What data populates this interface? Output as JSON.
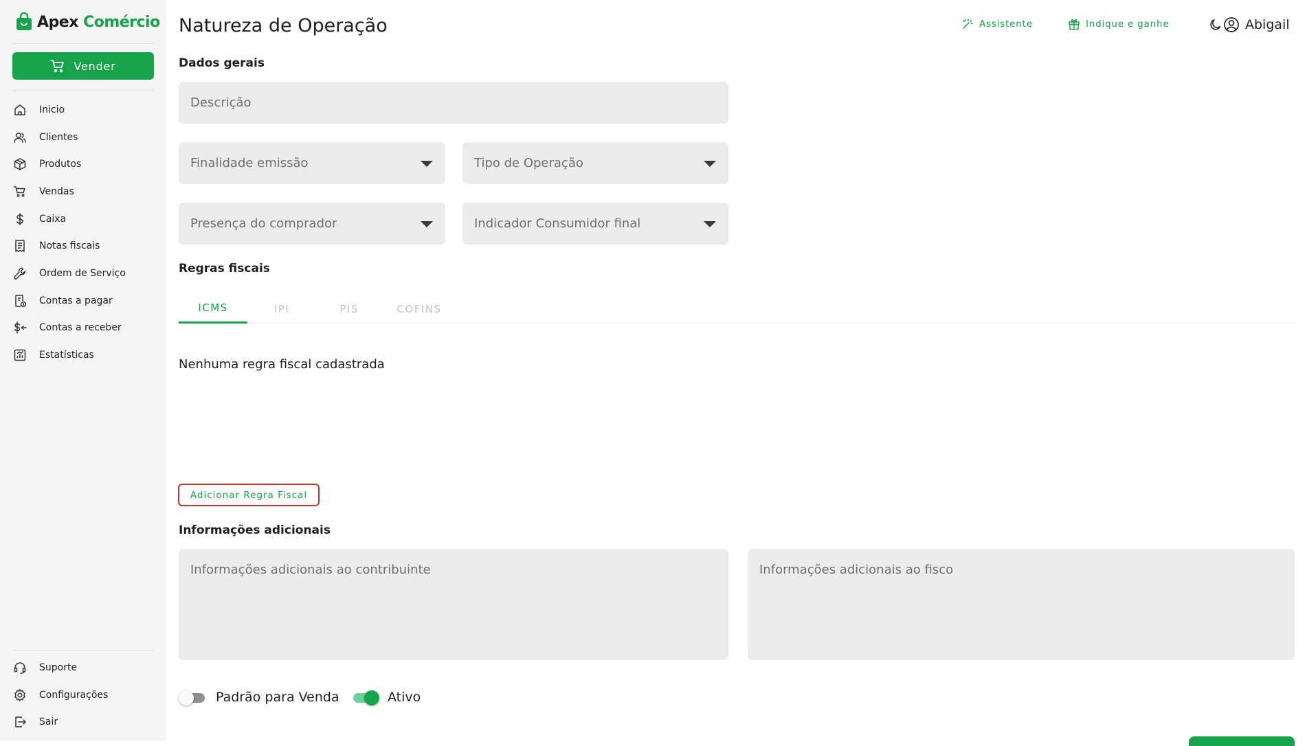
{
  "brand": {
    "name_part1": "Apex",
    "name_part2": "Comércio",
    "accent": "#16a34a"
  },
  "sidebar": {
    "sell_label": "Vender",
    "items": [
      {
        "label": "Inicio",
        "icon": "home-icon"
      },
      {
        "label": "Clientes",
        "icon": "users-icon"
      },
      {
        "label": "Produtos",
        "icon": "box-icon"
      },
      {
        "label": "Vendas",
        "icon": "cart-icon"
      },
      {
        "label": "Caixa",
        "icon": "dollar-icon"
      },
      {
        "label": "Notas fiscais",
        "icon": "receipt-icon"
      },
      {
        "label": "Ordem de Serviço",
        "icon": "wrench-icon"
      },
      {
        "label": "Contas a pagar",
        "icon": "bill-pay-icon"
      },
      {
        "label": "Contas a receber",
        "icon": "dollar-receive-icon"
      },
      {
        "label": "Estatísticas",
        "icon": "chart-icon"
      }
    ],
    "footer_items": [
      {
        "label": "Suporte",
        "icon": "headset-icon"
      },
      {
        "label": "Configurações",
        "icon": "gear-icon"
      },
      {
        "label": "Sair",
        "icon": "logout-icon"
      }
    ]
  },
  "header": {
    "title": "Natureza de Operação",
    "assistant_label": "Assistente",
    "refer_label": "Indique e ganhe",
    "user_name": "Abigail"
  },
  "form": {
    "general_section": "Dados gerais",
    "description_placeholder": "Descrição",
    "finalidade_placeholder": "Finalidade emissão",
    "tipo_operacao_placeholder": "Tipo de Operação",
    "presenca_placeholder": "Presença do comprador",
    "consumidor_placeholder": "Indicador Consumidor final",
    "fiscal_section": "Regras fiscais",
    "tabs": [
      "ICMS",
      "IPI",
      "PIS",
      "COFINS"
    ],
    "active_tab": "ICMS",
    "empty_message": "Nenhuma regra fiscal cadastrada",
    "add_rule_label": "Adicionar Regra Fiscal",
    "additional_section": "Informações adicionais",
    "info_contribuinte_placeholder": "Informações adicionais ao contribuinte",
    "info_fisco_placeholder": "Informações adicionais ao fisco",
    "toggle_default_label": "Padrão para Venda",
    "toggle_default_value": false,
    "toggle_active_label": "Ativo",
    "toggle_active_value": true
  }
}
